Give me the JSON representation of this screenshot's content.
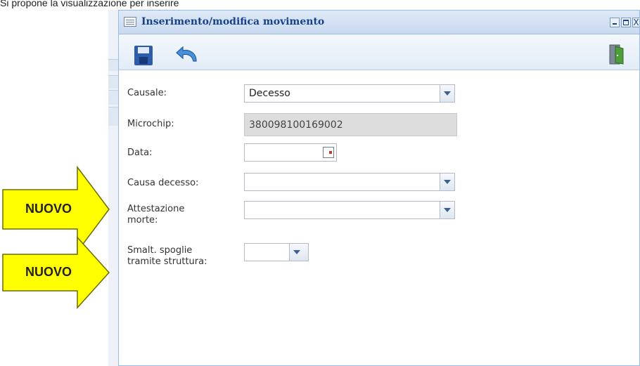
{
  "top_text": "Si propone la visualizzazione per inserire",
  "window": {
    "title": "Inserimento/modifica movimento",
    "minimize_glyph": "",
    "maximize_glyph": "",
    "close_glyph": "X"
  },
  "toolbar": {
    "save_icon": "save-floppy-icon",
    "undo_icon": "undo-arrow-icon",
    "exit_icon": "exit-door-icon"
  },
  "form": {
    "causale_label": "Causale:",
    "causale_value": "Decesso",
    "microchip_label": "Microchip:",
    "microchip_value": "380098100169002",
    "data_label": "Data:",
    "data_value": "",
    "causa_decesso_label": "Causa decesso:",
    "causa_decesso_value": "",
    "attestazione_label_line1": "Attestazione",
    "attestazione_label_line2": "morte:",
    "attestazione_value": "",
    "smalt_label_line1": "Smalt. spoglie",
    "smalt_label_line2": "tramite struttura:",
    "smalt_value": ""
  },
  "annotations": {
    "arrow1_label": "NUOVO",
    "arrow2_label": "NUOVO",
    "arrow_fill": "#ffff00",
    "arrow_stroke": "#6b6b00"
  },
  "colors": {
    "title_text": "#15428b",
    "window_border": "#99bbe8",
    "disabled_field": "#dddddd"
  }
}
